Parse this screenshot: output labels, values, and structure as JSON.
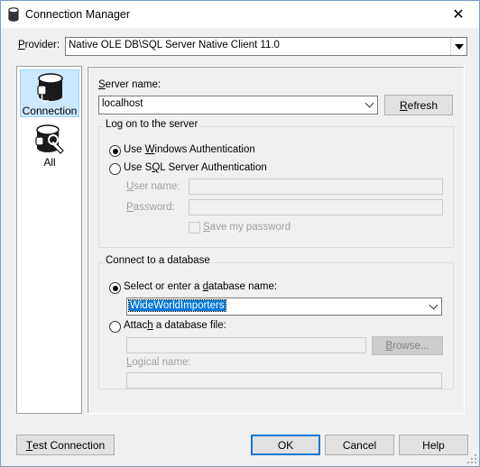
{
  "window": {
    "title": "Connection Manager",
    "close_glyph": "✕"
  },
  "provider": {
    "label_pre": "",
    "label_ul": "P",
    "label_post": "rovider:",
    "value": "Native OLE DB\\SQL Server Native Client 11.0"
  },
  "pages": [
    {
      "label": "Connection",
      "icon": "database-plug-icon",
      "selected": true
    },
    {
      "label": "All",
      "icon": "database-settings-icon",
      "selected": false
    }
  ],
  "server": {
    "label_ul": "S",
    "label_post": "erver name:",
    "value": "localhost",
    "refresh_ul": "R",
    "refresh_post": "efresh"
  },
  "logon": {
    "title": "Log on to the server",
    "windows_pre": "Use ",
    "windows_ul": "W",
    "windows_post": "indows Authentication",
    "windows_selected": true,
    "sql_pre": "Use S",
    "sql_ul": "Q",
    "sql_post": "L Server Authentication",
    "sql_selected": false,
    "user_ul": "U",
    "user_post": "ser name:",
    "user_value": "",
    "password_ul": "P",
    "password_post": "assword:",
    "password_value": "",
    "save_ul": "S",
    "save_post": "ave my password",
    "save_checked": false
  },
  "database": {
    "title": "Connect to a database",
    "select_pre": "Select or enter a ",
    "select_ul": "d",
    "select_post": "atabase name:",
    "select_selected": true,
    "db_value": "WideWorldImporters",
    "attach_pre": "Attac",
    "attach_ul": "h",
    "attach_post": " a database file:",
    "attach_selected": false,
    "attach_value": "",
    "browse_ul": "B",
    "browse_post": "rowse...",
    "logical_ul": "L",
    "logical_post": "ogical name:",
    "logical_value": ""
  },
  "footer": {
    "test_ul": "T",
    "test_post": "est Connection",
    "ok": "OK",
    "cancel": "Cancel",
    "help": "Help"
  },
  "colors": {
    "accent": "#0078d7",
    "selection_bg": "#cce8ff",
    "window_bg": "#f0f0f0"
  }
}
